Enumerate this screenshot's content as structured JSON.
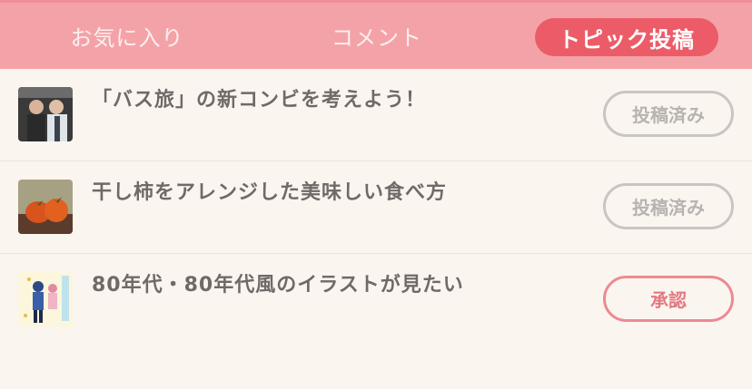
{
  "tabs": {
    "favorites": "お気に入り",
    "comments": "コメント",
    "topic_post": "トピック投稿"
  },
  "topics": [
    {
      "title": "「バス旅」の新コンビを考えよう！",
      "status": "投稿済み"
    },
    {
      "title": "干し柿をアレンジした美味しい食べ方",
      "status": "投稿済み"
    },
    {
      "title": "80年代・80年代風のイラストが見たい",
      "status": "承認"
    }
  ],
  "colors": {
    "tab_bg": "#f3a3a8",
    "active_tab": "#ec5c68",
    "posted_border": "#c9c5c3",
    "approve_border": "#ec8a93"
  }
}
